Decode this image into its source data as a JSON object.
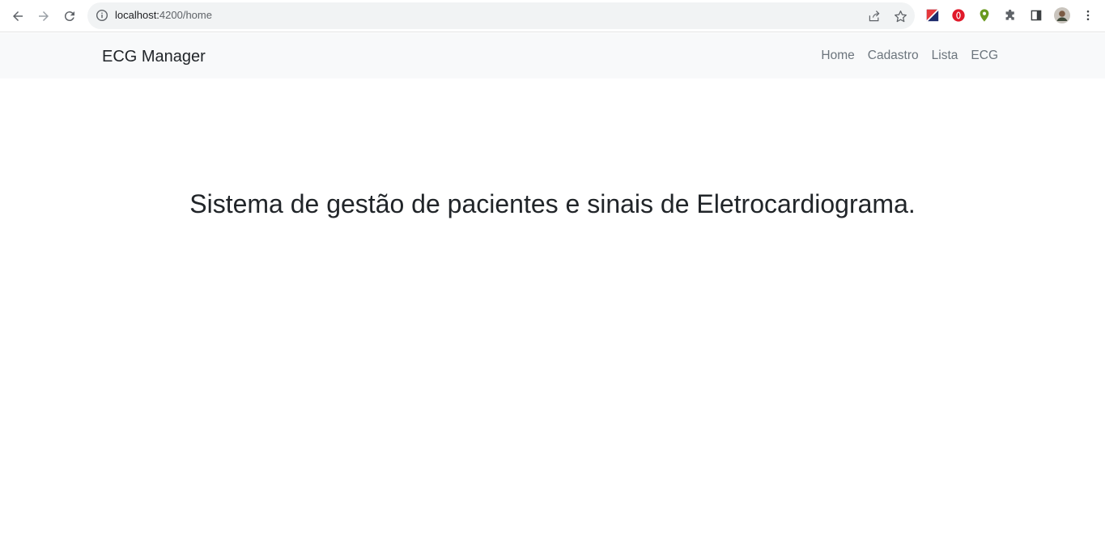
{
  "browser": {
    "url_host": "localhost:",
    "url_rest": "4200/home"
  },
  "navbar": {
    "brand": "ECG Manager",
    "links": [
      "Home",
      "Cadastro",
      "Lista",
      "ECG"
    ]
  },
  "main": {
    "headline": "Sistema de gestão de pacientes e sinais de Eletrocardiograma."
  },
  "colors": {
    "navbar_bg": "#f8f9fa",
    "link": "#6c757d",
    "text": "#212529"
  }
}
